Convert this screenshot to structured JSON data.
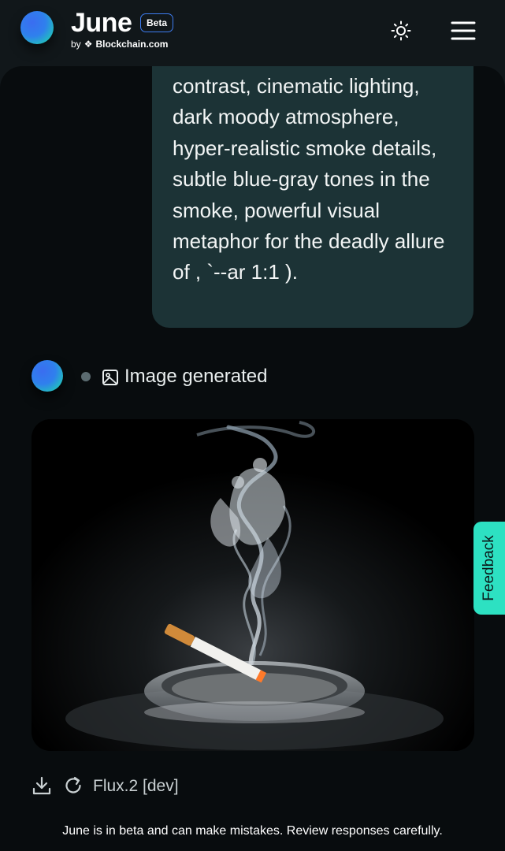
{
  "header": {
    "app_name": "June",
    "beta_label": "Beta",
    "by_label": "by",
    "company_icon": "blockchain-logo-icon",
    "company_name": "Blockchain.com",
    "theme_icon": "sun-icon",
    "menu_icon": "hamburger-menu-icon"
  },
  "conversation": {
    "user_message": "contrast, cinematic lighting, dark moody atmosphere, hyper-realistic smoke details, subtle blue-gray tones in the smoke, powerful visual metaphor for the deadly allure of , `--ar 1:1 ).",
    "assistant_status": "Image generated",
    "status_icon": "image-icon",
    "generated_image_icon": "generated-image",
    "actions": {
      "download_icon": "download-icon",
      "regenerate_icon": "refresh-icon",
      "model_name": "Flux.2 [dev]"
    }
  },
  "feedback_label": "Feedback",
  "disclaimer": "June is in beta and can make mistakes. Review responses carefully.",
  "colors": {
    "header_bg": "#11171a",
    "main_bg": "#080c0e",
    "user_bubble_bg": "#1c3336",
    "accent_blue": "#3e7cf0",
    "feedback_bg": "#2de1c2"
  }
}
